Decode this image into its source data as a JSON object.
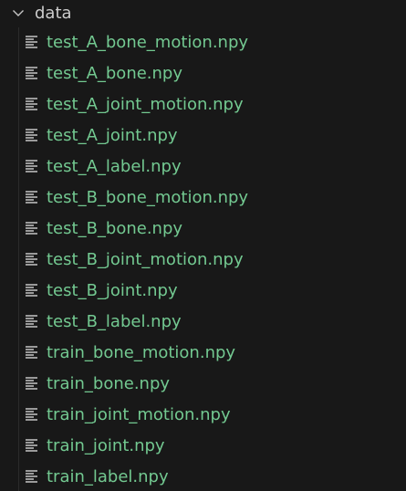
{
  "explorer": {
    "folder": {
      "name": "data",
      "expanded": true,
      "icon": "chevron-down-icon",
      "label_color": "#cccccc"
    },
    "file_icon": "lines-file-icon",
    "file_color": "#73c991",
    "files": [
      {
        "name": "test_A_bone_motion.npy"
      },
      {
        "name": "test_A_bone.npy"
      },
      {
        "name": "test_A_joint_motion.npy"
      },
      {
        "name": "test_A_joint.npy"
      },
      {
        "name": "test_A_label.npy"
      },
      {
        "name": "test_B_bone_motion.npy"
      },
      {
        "name": "test_B_bone.npy"
      },
      {
        "name": "test_B_joint_motion.npy"
      },
      {
        "name": "test_B_joint.npy"
      },
      {
        "name": "test_B_label.npy"
      },
      {
        "name": "train_bone_motion.npy"
      },
      {
        "name": "train_bone.npy"
      },
      {
        "name": "train_joint_motion.npy"
      },
      {
        "name": "train_joint.npy"
      },
      {
        "name": "train_label.npy"
      }
    ]
  }
}
